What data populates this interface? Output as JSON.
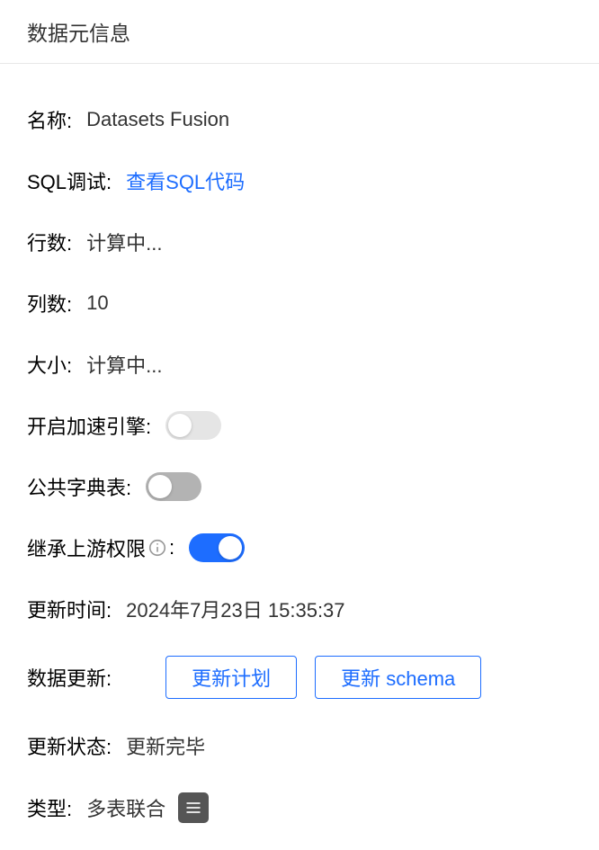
{
  "header": {
    "title": "数据元信息"
  },
  "fields": {
    "name": {
      "label": "名称:",
      "value": "Datasets Fusion"
    },
    "sql_debug": {
      "label": "SQL调试:",
      "link_text": "查看SQL代码"
    },
    "rows": {
      "label": "行数:",
      "value": "计算中..."
    },
    "cols": {
      "label": "列数:",
      "value": "10"
    },
    "size": {
      "label": "大小:",
      "value": "计算中..."
    },
    "accel_engine": {
      "label": "开启加速引擎:",
      "on": false
    },
    "public_dict": {
      "label": "公共字典表:",
      "on": false
    },
    "inherit_perm": {
      "label": "继承上游权限",
      "colon": ":",
      "on": true
    },
    "update_time": {
      "label": "更新时间:",
      "value": "2024年7月23日 15:35:37"
    },
    "data_update": {
      "label": "数据更新:",
      "btn_plan": "更新计划",
      "btn_schema": "更新 schema"
    },
    "update_status": {
      "label": "更新状态:",
      "value": "更新完毕"
    },
    "type": {
      "label": "类型:",
      "value": "多表联合"
    }
  }
}
